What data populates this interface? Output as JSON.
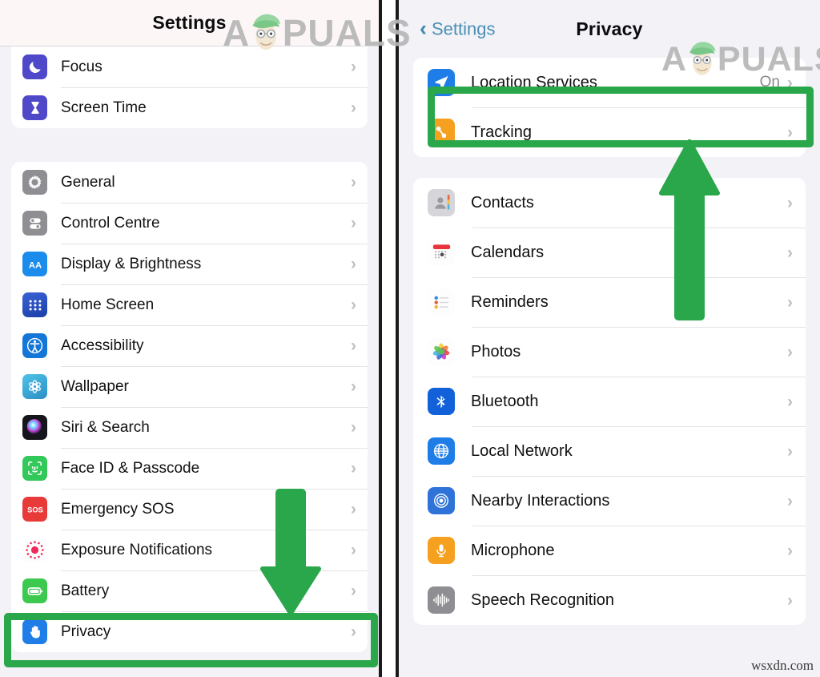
{
  "left_panel": {
    "nav": {
      "title": "Settings"
    },
    "groups": [
      {
        "id": "group-focus",
        "rows": [
          {
            "label": "Focus",
            "icon": "moon-icon",
            "icon_bg": "#4f48c9",
            "accessory": "chevron"
          },
          {
            "label": "Screen Time",
            "icon": "hourglass-icon",
            "icon_bg": "#4f48c9",
            "accessory": "chevron"
          }
        ]
      },
      {
        "id": "group-system",
        "rows": [
          {
            "label": "General",
            "icon": "gear-icon",
            "icon_bg": "#8e8e93",
            "accessory": "chevron"
          },
          {
            "label": "Control Centre",
            "icon": "sliders-icon",
            "icon_bg": "#8e8e93",
            "accessory": "chevron"
          },
          {
            "label": "Display & Brightness",
            "icon": "aa-text-icon",
            "icon_bg": "#1b8ceb",
            "accessory": "chevron"
          },
          {
            "label": "Home Screen",
            "icon": "home-grid-icon",
            "icon_bg": "#2e55c8",
            "accessory": "chevron"
          },
          {
            "label": "Accessibility",
            "icon": "accessibility-person-icon",
            "icon_bg": "#1477d8",
            "accessory": "chevron"
          },
          {
            "label": "Wallpaper",
            "icon": "flower-icon",
            "icon_bg": "#35aad1",
            "accessory": "chevron"
          },
          {
            "label": "Siri & Search",
            "icon": "siri-orb-icon",
            "icon_bg": "#1c1c22",
            "accessory": "chevron"
          },
          {
            "label": "Face ID & Passcode",
            "icon": "face-id-icon",
            "icon_bg": "#32c85a",
            "accessory": "chevron"
          },
          {
            "label": "Emergency SOS",
            "icon": "sos-icon",
            "icon_bg": "#e93a3a",
            "accessory": "chevron"
          },
          {
            "label": "Exposure Notifications",
            "icon": "exposure-dot-icon",
            "icon_bg": "#fdfdfd",
            "accessory": "chevron"
          },
          {
            "label": "Battery",
            "icon": "battery-icon",
            "icon_bg": "#3bc94f",
            "accessory": "chevron"
          },
          {
            "label": "Privacy",
            "icon": "hand-raised-icon",
            "icon_bg": "#1f7de8",
            "accessory": "chevron"
          }
        ]
      }
    ],
    "highlight": {
      "target_label": "Privacy",
      "color": "#2aa64b"
    },
    "arrow": {
      "direction": "down",
      "color": "#2aa64b",
      "points_to": "Privacy"
    }
  },
  "right_panel": {
    "nav": {
      "back_label": "Settings",
      "title": "Privacy",
      "back_icon": "chevron-left-icon"
    },
    "groups": [
      {
        "id": "group-location",
        "rows": [
          {
            "label": "Location Services",
            "icon": "location-arrow-icon",
            "icon_bg": "#1f7de8",
            "value": "On",
            "accessory": "chevron"
          },
          {
            "label": "Tracking",
            "icon": "tracking-icon",
            "icon_bg": "#f5a01e",
            "value": "",
            "accessory": "chevron"
          }
        ]
      },
      {
        "id": "group-app-permissions",
        "rows": [
          {
            "label": "Contacts",
            "icon": "contacts-icon",
            "icon_bg": "#d7d7dc",
            "value": "",
            "accessory": "chevron"
          },
          {
            "label": "Calendars",
            "icon": "calendar-icon",
            "icon_bg": "#ffffff",
            "value": "",
            "accessory": "chevron"
          },
          {
            "label": "Reminders",
            "icon": "reminders-icon",
            "icon_bg": "#ffffff",
            "value": "",
            "accessory": "chevron"
          },
          {
            "label": "Photos",
            "icon": "photos-icon",
            "icon_bg": "#ffffff",
            "value": "",
            "accessory": "chevron"
          },
          {
            "label": "Bluetooth",
            "icon": "bluetooth-icon",
            "icon_bg": "#1261d8",
            "value": "",
            "accessory": "chevron"
          },
          {
            "label": "Local Network",
            "icon": "globe-icon",
            "icon_bg": "#1f7de8",
            "value": "",
            "accessory": "chevron"
          },
          {
            "label": "Nearby Interactions",
            "icon": "nearby-radar-icon",
            "icon_bg": "#2f73d8",
            "value": "",
            "accessory": "chevron"
          },
          {
            "label": "Microphone",
            "icon": "microphone-icon",
            "icon_bg": "#f5a01e",
            "value": "",
            "accessory": "chevron"
          },
          {
            "label": "Speech Recognition",
            "icon": "waveform-icon",
            "icon_bg": "#8e8e93",
            "value": "",
            "accessory": "chevron"
          }
        ]
      }
    ],
    "highlight": {
      "target_label": "Location Services",
      "color": "#2aa64b"
    },
    "arrow": {
      "direction": "up",
      "color": "#2aa64b",
      "points_to": "Location Services"
    }
  },
  "watermarks": {
    "brand_left": {
      "a": "A",
      "rest": "PUALS"
    },
    "brand_right": {
      "a": "A",
      "rest": "PUALS"
    },
    "credit": "wsxdn.com"
  },
  "glyphs": {
    "chevron_right": "›",
    "chevron_left": "‹"
  }
}
